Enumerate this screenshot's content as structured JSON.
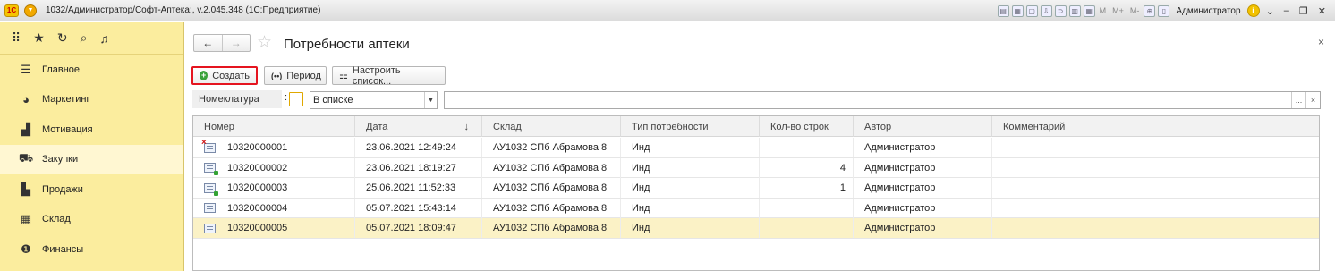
{
  "titlebar": {
    "logo": "1С",
    "title": "1032/Администратор/Софт-Аптека:, v.2.045.348  (1С:Предприятие)",
    "mem": [
      "M",
      "M+",
      "M-"
    ],
    "user": "Администратор",
    "info": "i"
  },
  "sidebar": {
    "top_icons": [
      "apps-grid-icon",
      "star-icon",
      "history-icon",
      "search-icon",
      "bell-icon"
    ],
    "items": [
      {
        "label": "Главное",
        "icon": "menu-icon"
      },
      {
        "label": "Маркетинг",
        "icon": "pie-chart-icon"
      },
      {
        "label": "Мотивация",
        "icon": "bar-chart-icon"
      },
      {
        "label": "Закупки",
        "icon": "cart-icon",
        "active": true
      },
      {
        "label": "Продажи",
        "icon": "bag-icon"
      },
      {
        "label": "Склад",
        "icon": "warehouse-icon"
      },
      {
        "label": "Финансы",
        "icon": "coin-icon"
      }
    ]
  },
  "page": {
    "title": "Потребности аптеки",
    "back": "←",
    "forward": "→",
    "close": "×"
  },
  "toolbar": {
    "create_label": "Создать",
    "create_icon": "+",
    "period_label": "Период",
    "period_icon": "(••)",
    "setup_label": "Настроить список..."
  },
  "filter": {
    "label": "Номеклатура",
    "condition": "В списке",
    "value": "",
    "dots": "...",
    "clear": "×"
  },
  "table": {
    "columns": [
      "Номер",
      "Дата",
      "Склад",
      "Тип потребности",
      "Кол-во строк",
      "Автор",
      "Комментарий"
    ],
    "sort_indicator": "↓",
    "rows": [
      {
        "number": "10320000001",
        "date": "23.06.2021 12:49:24",
        "warehouse": "АУ1032 СПб Абрамова 8",
        "type": "Инд",
        "lines": "",
        "author": "Администратор",
        "comment": "",
        "state": "deleted"
      },
      {
        "number": "10320000002",
        "date": "23.06.2021 18:19:27",
        "warehouse": "АУ1032 СПб Абрамова 8",
        "type": "Инд",
        "lines": "4",
        "author": "Администратор",
        "comment": "",
        "state": "posted"
      },
      {
        "number": "10320000003",
        "date": "25.06.2021 11:52:33",
        "warehouse": "АУ1032 СПб Абрамова 8",
        "type": "Инд",
        "lines": "1",
        "author": "Администратор",
        "comment": "",
        "state": "posted"
      },
      {
        "number": "10320000004",
        "date": "05.07.2021 15:43:14",
        "warehouse": "АУ1032 СПб Абрамова 8",
        "type": "Инд",
        "lines": "",
        "author": "Администратор",
        "comment": "",
        "state": "draft"
      },
      {
        "number": "10320000005",
        "date": "05.07.2021 18:09:47",
        "warehouse": "АУ1032 СПб Абрамова 8",
        "type": "Инд",
        "lines": "",
        "author": "Администратор",
        "comment": "",
        "state": "draft",
        "selected": true
      }
    ]
  },
  "colors": {
    "sidebar_bg": "#fbed9e",
    "selected_row": "#fbf2c6",
    "create_highlight": "#e5141f",
    "create_icon": "#3aa23a"
  }
}
